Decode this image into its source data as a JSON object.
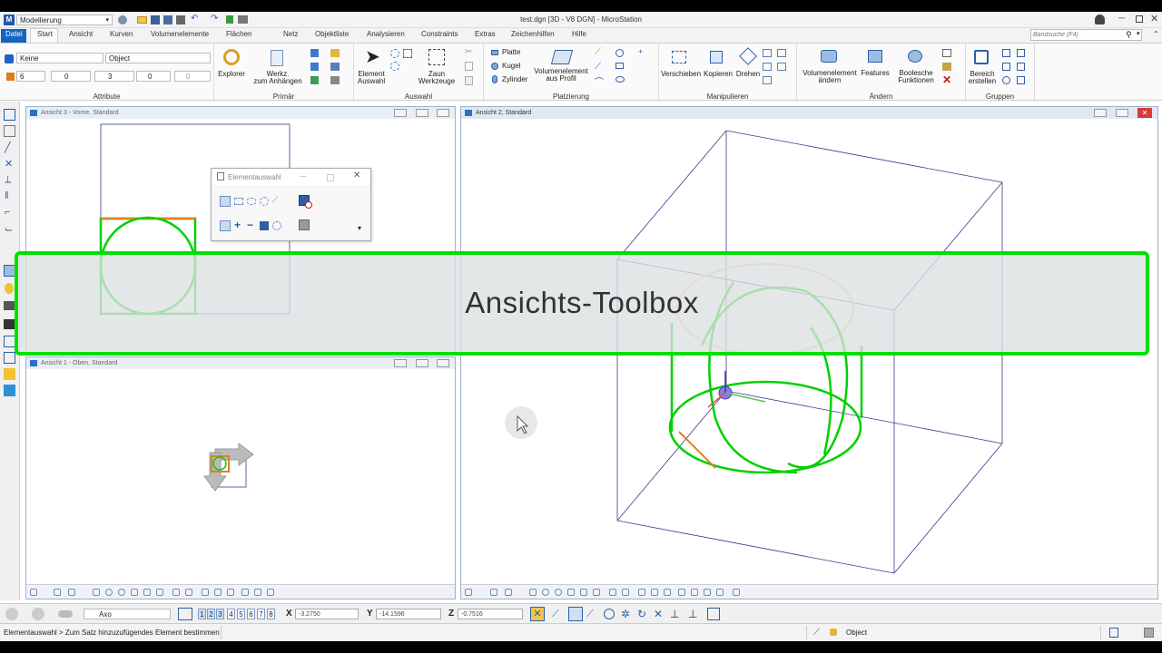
{
  "window": {
    "title": "test.dgn [3D - V8 DGN] - MicroStation",
    "workflow": "Modellierung"
  },
  "search": {
    "placeholder": "Bandsuche (F4)"
  },
  "tabs": [
    "Datei",
    "Start",
    "Ansicht",
    "Kurven",
    "Volumenelemente",
    "Flächen",
    "Netz",
    "Objektliste",
    "Analysieren",
    "Constraints",
    "Extras",
    "Zeichenhilfen",
    "Hilfe"
  ],
  "active_tab": "Start",
  "ribbon": {
    "attribute": {
      "level": "Keine",
      "style": "Object",
      "color": "6",
      "linestyle": "0",
      "weight": "3",
      "transparency": "0",
      "priority": "0",
      "label": "Attribute"
    },
    "primaer": {
      "explorer": "Explorer",
      "werkz_1": "Werkz.",
      "werkz_2": "zum Anhängen",
      "label": "Primär"
    },
    "auswahl": {
      "element_1": "Element",
      "element_2": "Auswahl",
      "zaun_1": "Zaun",
      "zaun_2": "Werkzeuge",
      "label": "Auswahl"
    },
    "platzierung": {
      "platte": "Platte",
      "kugel": "Kugel",
      "zylinder": "Zylinder",
      "vol_1": "Volumenelement",
      "vol_2": "aus Profil",
      "label": "Platzierung"
    },
    "manipulieren": {
      "verschieben": "Verschieben",
      "kopieren": "Kopieren",
      "drehen": "Drehen",
      "label": "Manipulieren"
    },
    "aendern": {
      "vol_1": "Volumenelement",
      "vol_2": "ändern",
      "features": "Features",
      "bool_1": "Boolesche",
      "bool_2": "Funktionen",
      "label": "Ändern"
    },
    "gruppen": {
      "bereich_1": "Bereich",
      "bereich_2": "erstellen",
      "label": "Gruppen"
    }
  },
  "views": {
    "v3": {
      "title": "Ansicht 3 - Vorne, Standard"
    },
    "v1": {
      "title": "Ansicht 1 - Oben, Standard"
    },
    "v2": {
      "title": "Ansicht 2, Standard"
    }
  },
  "dialog": {
    "title": "Elementauswahl"
  },
  "bottom": {
    "view_mode": "Axo",
    "view_numbers": [
      "1",
      "2",
      "3",
      "4",
      "5",
      "6",
      "7",
      "8"
    ],
    "x_label": "X",
    "x_value": "-3.2750",
    "y_label": "Y",
    "y_value": "-14.1596",
    "z_label": "Z",
    "z_value": "-0.7516"
  },
  "status": {
    "prompt": "Elementauswahl > Zum Satz hinzuzufügendes Element bestimmen",
    "active_level": "Object"
  },
  "overlay": {
    "caption": "Ansichts-Toolbox"
  },
  "colors": {
    "accent": "#1565c0",
    "highlight": "#00e000",
    "overlay_bg": "#dce0e2"
  }
}
